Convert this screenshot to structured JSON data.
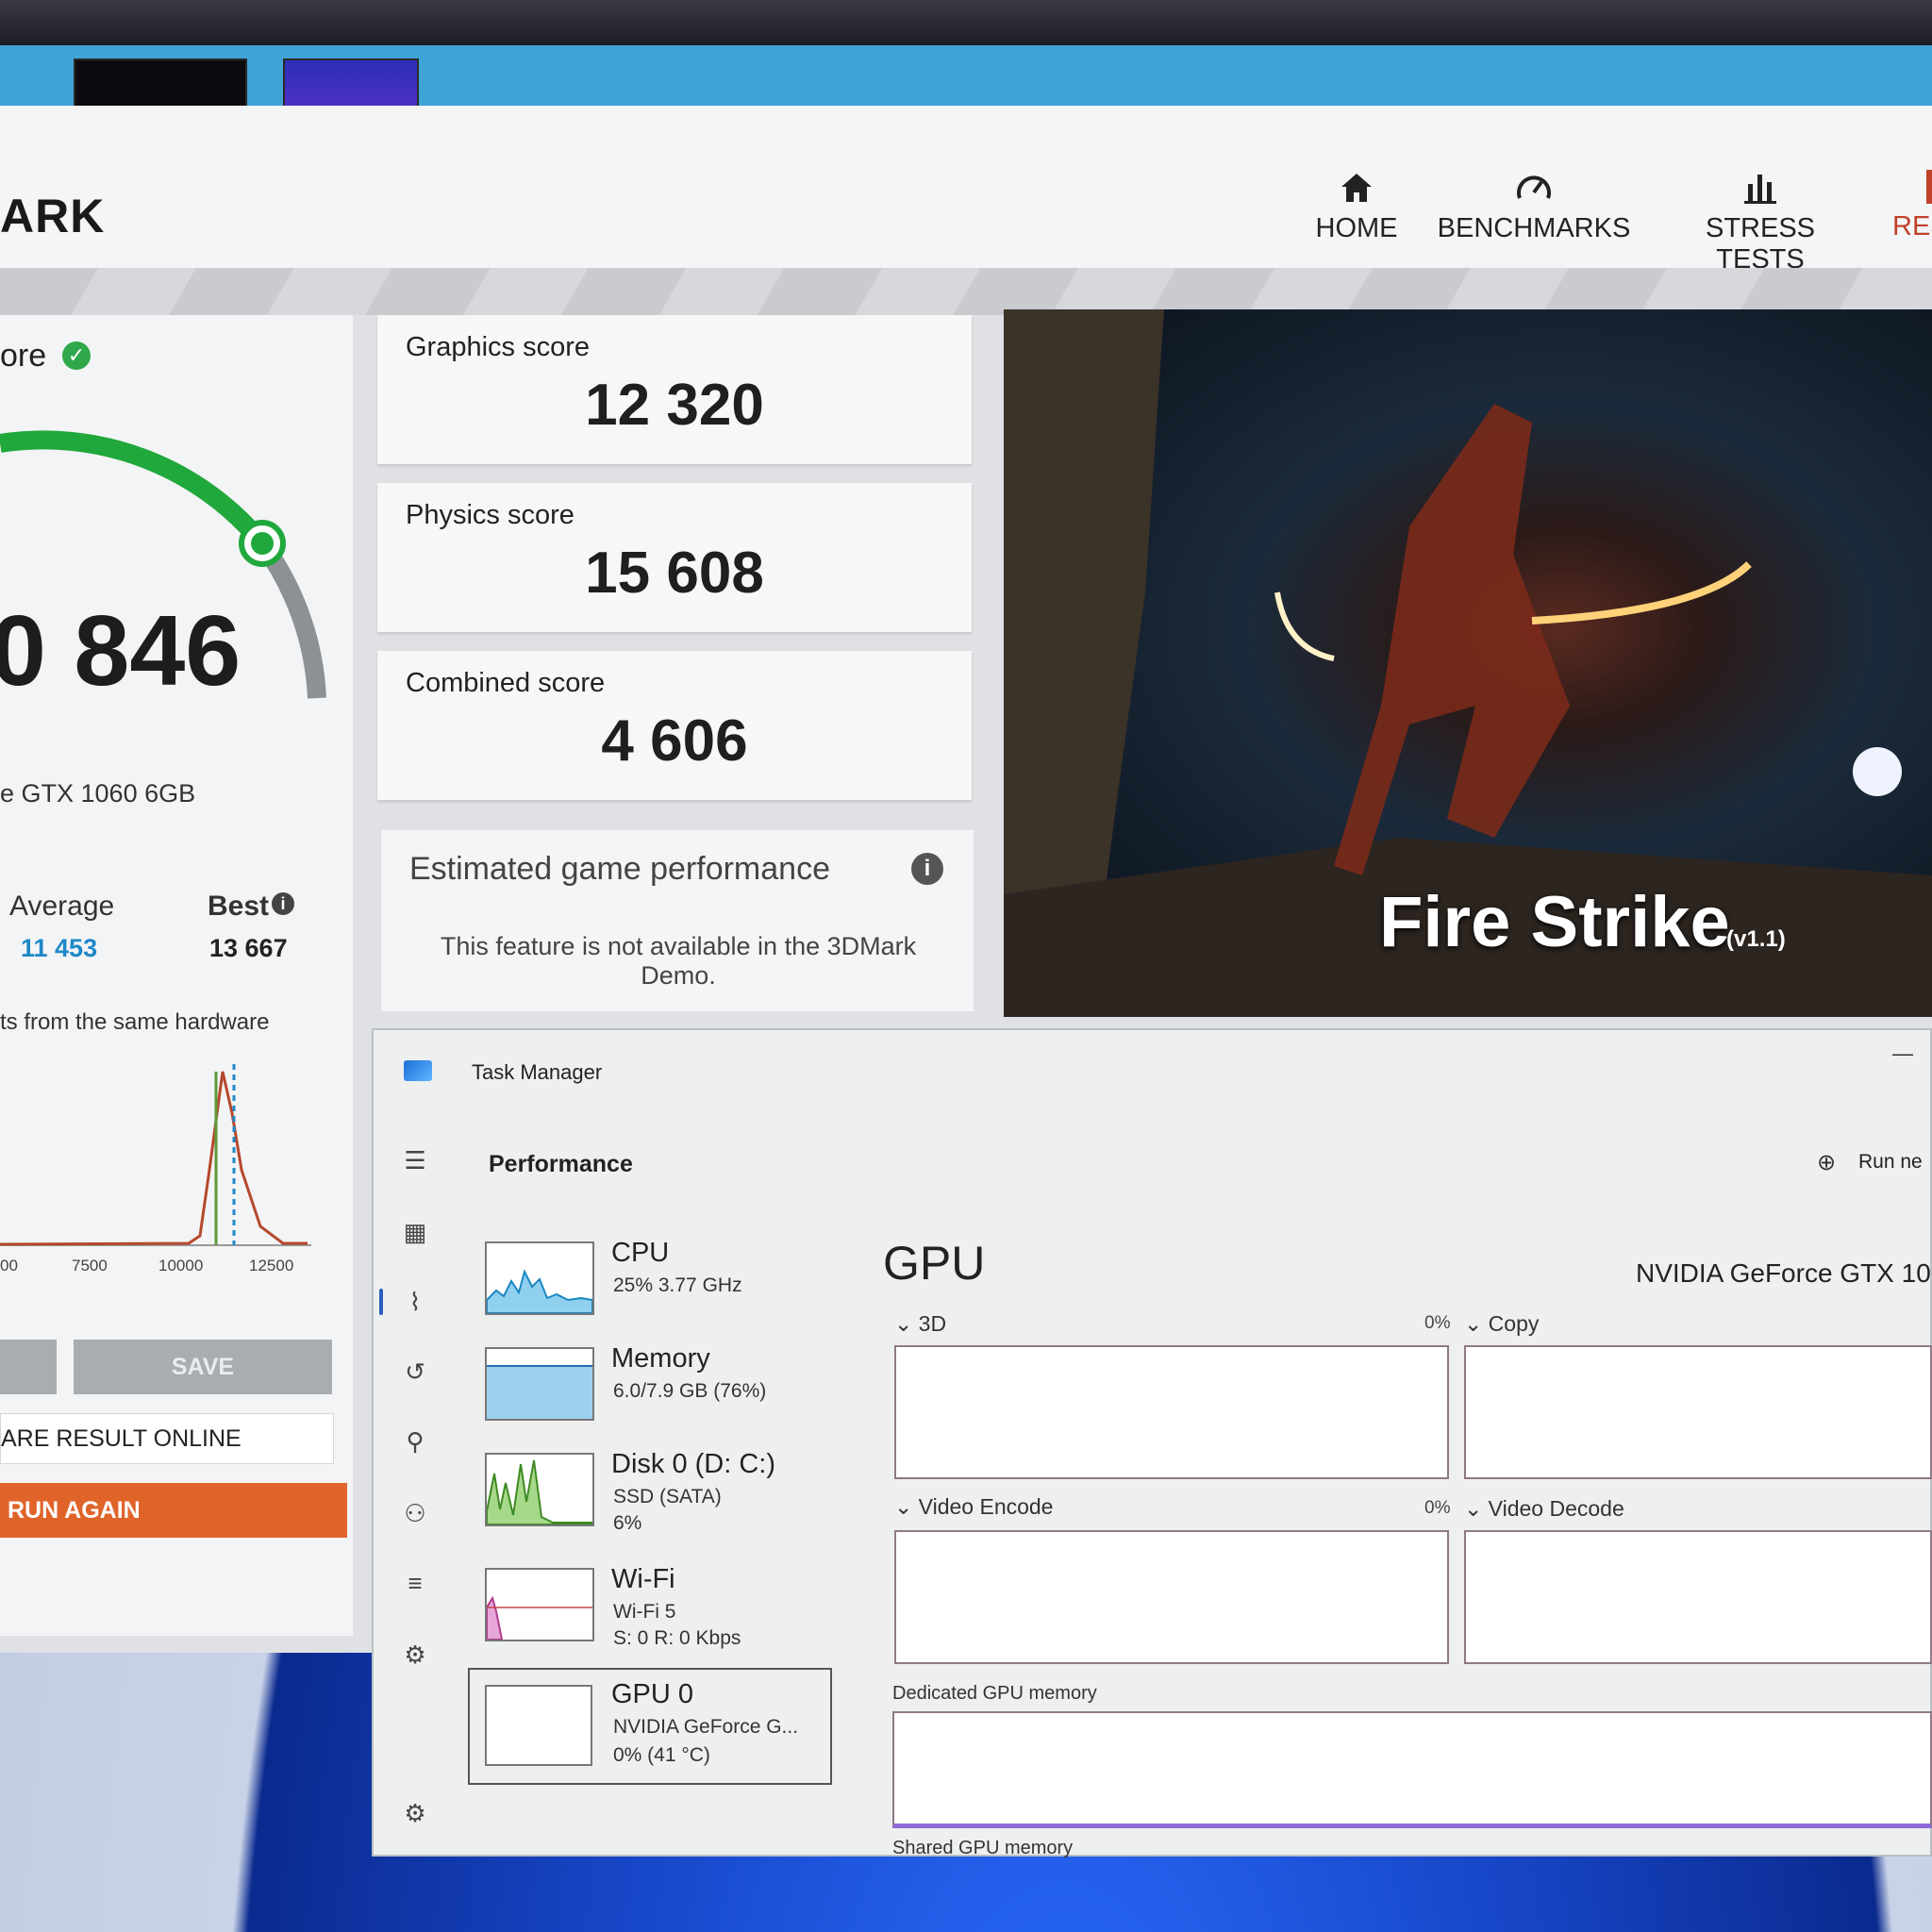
{
  "threedmark": {
    "logo_partial": "ARK",
    "nav": [
      {
        "label": "HOME",
        "icon": "home-icon"
      },
      {
        "label": "BENCHMARKS",
        "icon": "gauge-icon"
      },
      {
        "label": "STRESS TESTS",
        "icon": "bar-chart-icon"
      },
      {
        "label": "RES",
        "icon": "results-icon"
      }
    ],
    "score_title_partial": "ore",
    "main_score_partial": "0 846",
    "gpu_partial": "e GTX 1060 6GB",
    "average_label": "Average",
    "average_value": "11 453",
    "best_label": "Best",
    "best_value": "13 667",
    "same_hardware_partial": "ts from the same hardware",
    "chart_ticks": [
      "00",
      "7500",
      "10000",
      "12500"
    ],
    "save_label": "SAVE",
    "share_label_partial": "ARE RESULT ONLINE",
    "run_again_label": "RUN AGAIN",
    "scores": [
      {
        "title": "Graphics score",
        "value": "12 320"
      },
      {
        "title": "Physics score",
        "value": "15 608"
      },
      {
        "title": "Combined score",
        "value": "4 606"
      }
    ],
    "estimated_title": "Estimated game performance",
    "estimated_message": "This feature is not available in the 3DMark Demo.",
    "benchmark_title": "Fire Strike",
    "benchmark_version": "(v1.1)",
    "colors": {
      "accent_green": "#2ea84a",
      "run_orange": "#e0642a",
      "average_blue": "#1e88c8"
    }
  },
  "task_manager": {
    "title": "Task Manager",
    "section": "Performance",
    "run_new_partial": "Run ne",
    "items": [
      {
        "name": "CPU",
        "sub1": "25%  3.77 GHz",
        "sub2": "",
        "sub3": ""
      },
      {
        "name": "Memory",
        "sub1": "6.0/7.9 GB (76%)",
        "sub2": "",
        "sub3": ""
      },
      {
        "name": "Disk 0 (D: C:)",
        "sub1": "SSD (SATA)",
        "sub2": "6%",
        "sub3": ""
      },
      {
        "name": "Wi-Fi",
        "sub1": "Wi-Fi 5",
        "sub2": "S: 0  R: 0 Kbps",
        "sub3": ""
      },
      {
        "name": "GPU 0",
        "sub1": "NVIDIA GeForce G...",
        "sub2": "0%  (41 °C)",
        "sub3": ""
      }
    ],
    "gpu_heading": "GPU",
    "gpu_model_partial": "NVIDIA GeForce GTX 10",
    "graphs": [
      {
        "label": "3D",
        "pct": "0%"
      },
      {
        "label": "Copy",
        "pct": ""
      },
      {
        "label": "Video Encode",
        "pct": "0%"
      },
      {
        "label": "Video Decode",
        "pct": ""
      }
    ],
    "dedicated_label": "Dedicated GPU memory",
    "shared_label": "Shared GPU memory"
  }
}
